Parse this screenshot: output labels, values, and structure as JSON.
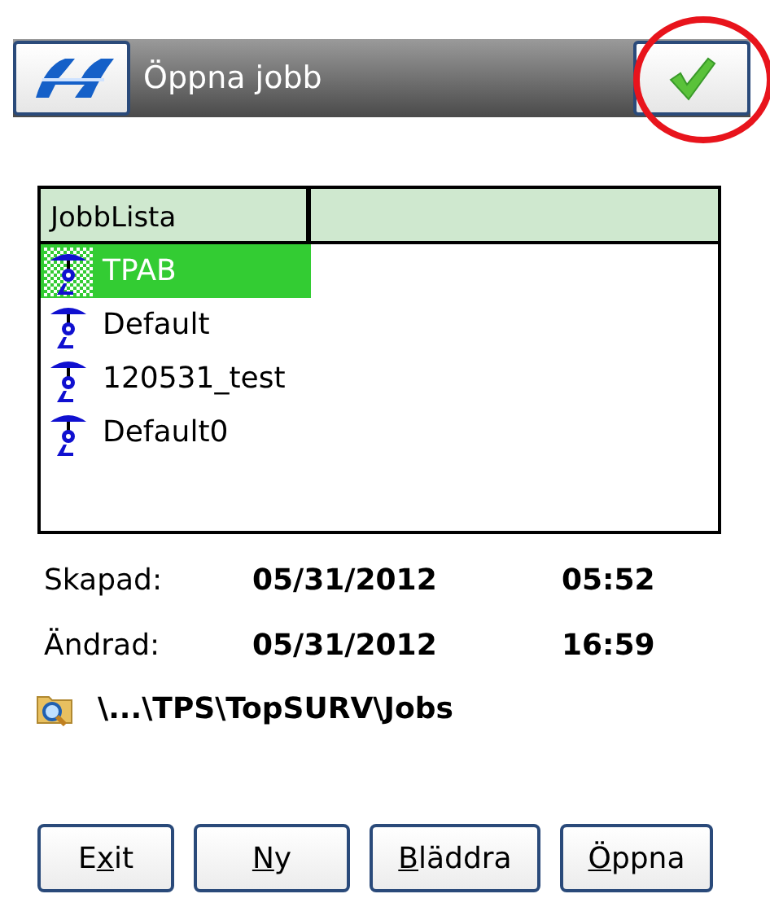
{
  "title_bar": {
    "title": "Öppna jobb",
    "confirm_highlighted": true
  },
  "job_list": {
    "columns": [
      "JobbLista"
    ],
    "rows": [
      {
        "name": "TPAB",
        "selected": true
      },
      {
        "name": "Default",
        "selected": false
      },
      {
        "name": "120531_test",
        "selected": false
      },
      {
        "name": "Default0",
        "selected": false
      }
    ]
  },
  "details": [
    {
      "label": "Skapad:",
      "date": "05/31/2012",
      "time": "05:52"
    },
    {
      "label": "Ändrad:",
      "date": "05/31/2012",
      "time": "16:59"
    }
  ],
  "path": "\\...\\TPS\\TopSURV\\Jobs",
  "buttons": [
    {
      "before": "E",
      "key": "x",
      "after": "it"
    },
    {
      "key": "N",
      "after": "y"
    },
    {
      "key": "B",
      "after": "läddra"
    },
    {
      "key": "Ö",
      "after": "ppna"
    }
  ]
}
